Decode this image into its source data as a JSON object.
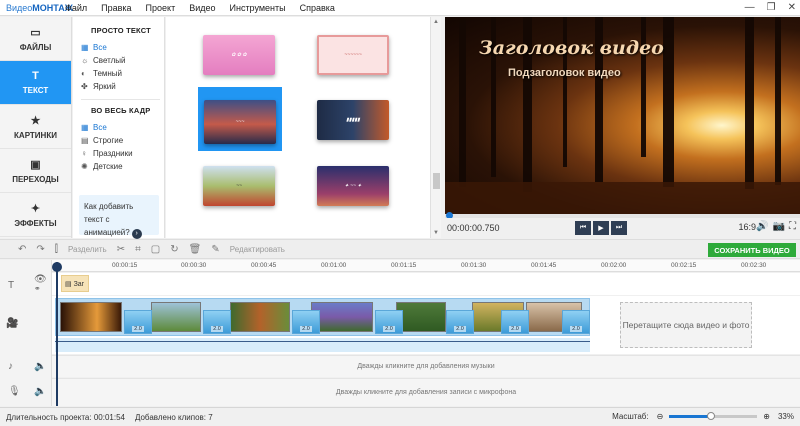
{
  "app": {
    "logo_a": "Видео",
    "logo_b": "МОНТАЖ"
  },
  "menu": [
    "Файл",
    "Правка",
    "Проект",
    "Видео",
    "Инструменты",
    "Справка"
  ],
  "window_buttons": [
    "—",
    "❐",
    "✕"
  ],
  "nav": [
    {
      "label": "ФАЙЛЫ",
      "icon": "▭"
    },
    {
      "label": "ТЕКСТ",
      "icon": "T"
    },
    {
      "label": "КАРТИНКИ",
      "icon": "★"
    },
    {
      "label": "ПЕРЕХОДЫ",
      "icon": "▣"
    },
    {
      "label": "ЭФФЕКТЫ",
      "icon": "✦"
    }
  ],
  "categories": {
    "group1": "ПРОСТО ТЕКСТ",
    "items1": [
      {
        "label": "Все",
        "icon": "▦"
      },
      {
        "label": "Светлый",
        "icon": "☼"
      },
      {
        "label": "Темный",
        "icon": "◐"
      },
      {
        "label": "Яркий",
        "icon": "✤"
      }
    ],
    "group2": "ВО ВЕСЬ КАДР",
    "items2": [
      {
        "label": "Все",
        "icon": "▦"
      },
      {
        "label": "Строгие",
        "icon": "▤"
      },
      {
        "label": "Праздники",
        "icon": "♀"
      },
      {
        "label": "Детские",
        "icon": "✺"
      }
    ],
    "howto": "Как добавить текст с анимацией?",
    "howto_icon": "›"
  },
  "preview": {
    "title": "Заголовок видео",
    "subtitle": "Подзаголовок видео",
    "timecode": "00:00:00.750",
    "ratio": "16:9",
    "buttons": [
      "⏮",
      "▶",
      "⏭"
    ],
    "icons": [
      "🔊",
      "📷",
      "⛶"
    ]
  },
  "toolbar": {
    "undo": "↶",
    "redo": "↷",
    "split": "Разделить",
    "edit": "Редактировать",
    "save": "СОХРАНИТЬ ВИДЕО"
  },
  "ruler": [
    "00:00:15",
    "00:00:30",
    "00:00:45",
    "00:01:00",
    "00:01:15",
    "00:01:30",
    "00:01:45",
    "00:02:00",
    "00:02:15",
    "00:02:30"
  ],
  "timeline": {
    "title_clip": "Заг",
    "transition_label": "2.0",
    "drop_text": "Перетащите сюда видео и фото",
    "music_hint": "Дважды кликните для добавления музыки",
    "mic_hint": "Дважды кликните для добавления записи с микрофона"
  },
  "status": {
    "duration_label": "Длительность проекта:",
    "duration": "00:01:54",
    "clips_label": "Добавлено клипов:",
    "clips": "7",
    "zoom_label": "Масштаб:",
    "zoom_value": "33%",
    "zoom_fraction": 0.47
  },
  "colors": {
    "accent": "#2196f3",
    "save": "#2eaa3a",
    "dark": "#2f3e54"
  }
}
